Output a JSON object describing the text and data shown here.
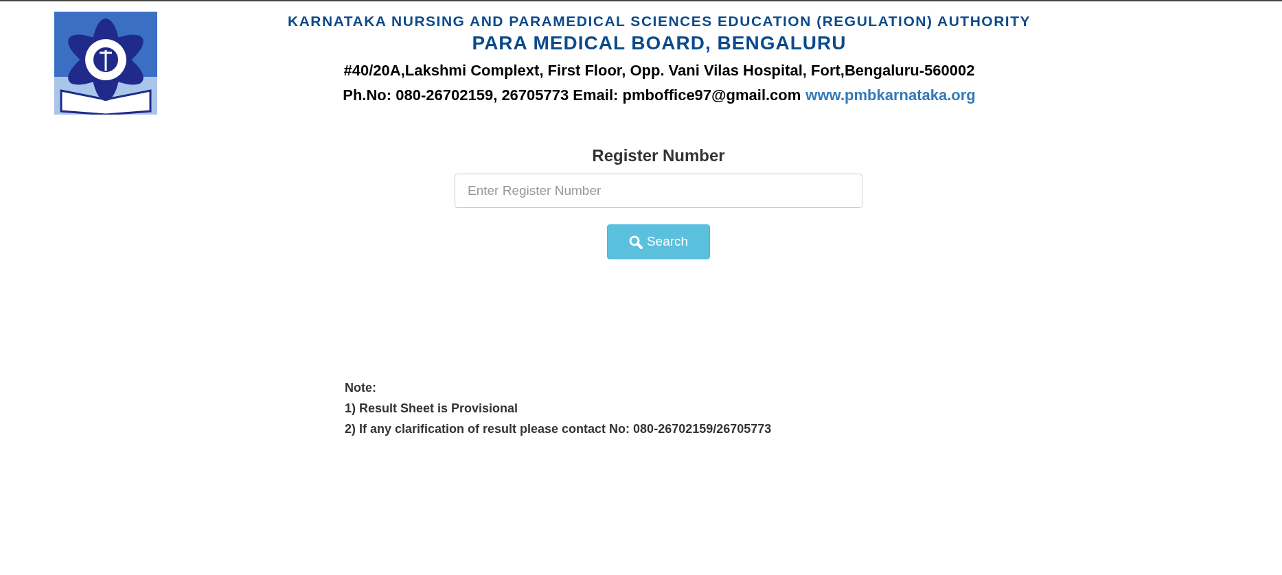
{
  "header": {
    "authority": "KARNATAKA NURSING AND PARAMEDICAL SCIENCES EDUCATION (REGULATION) AUTHORITY",
    "board": "PARA MEDICAL BOARD, BENGALURU",
    "address": "#40/20A,Lakshmi Complext, First Floor, Opp. Vani Vilas Hospital, Fort,Bengaluru-560002",
    "contact": "Ph.No: 080-26702159, 26705773 Email: pmboffice97@gmail.com",
    "website": "www.pmbkarnataka.org"
  },
  "form": {
    "heading": "Register Number",
    "search": {
      "placeholder": "Enter Register Number"
    },
    "button": "Search"
  },
  "note": {
    "title": "Note:",
    "lines": [
      "1) Result Sheet is Provisional",
      "2) If any clarification of result please contact No: 080-26702159/26705773"
    ]
  }
}
